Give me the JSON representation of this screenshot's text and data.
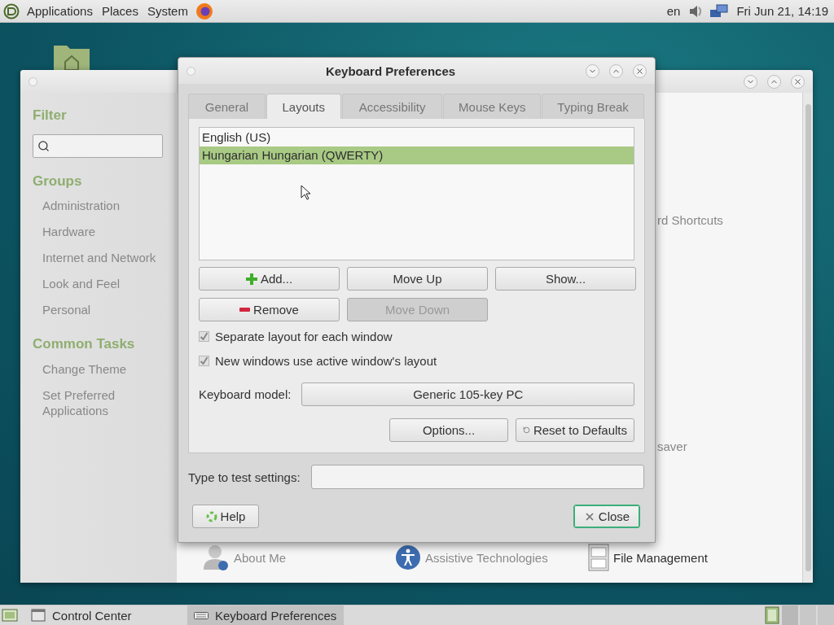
{
  "top_panel": {
    "menus": [
      "Applications",
      "Places",
      "System"
    ],
    "keyboard_layout": "en",
    "clock": "Fri Jun 21, 14:19"
  },
  "control_center": {
    "sidebar": [
      {
        "heading": "Filter",
        "kind": "search"
      },
      {
        "heading": "Groups",
        "kind": "links",
        "items": [
          "Administration",
          "Hardware",
          "Internet and Network",
          "Look and Feel",
          "Personal"
        ]
      },
      {
        "heading": "Common Tasks",
        "kind": "links",
        "items": [
          "Change Theme",
          "Set Preferred Applications"
        ]
      }
    ],
    "partial_items": [
      "rd Shortcuts",
      "saver"
    ],
    "items": [
      {
        "label": "About Me",
        "kind": "person",
        "dimmed": true
      },
      {
        "label": "Assistive Technologies",
        "kind": "accessibility",
        "dimmed": true
      },
      {
        "label": "File Management",
        "kind": "cabinet",
        "dimmed": false
      }
    ]
  },
  "dialog": {
    "title": "Keyboard Preferences",
    "tabs": [
      {
        "label": "General",
        "selected": false
      },
      {
        "label": "Layouts",
        "selected": true
      },
      {
        "label": "Accessibility",
        "selected": false
      },
      {
        "label": "Mouse Keys",
        "selected": false
      },
      {
        "label": "Typing Break",
        "selected": false
      }
    ],
    "layouts": [
      {
        "label": "English (US)",
        "selected": false
      },
      {
        "label": "Hungarian Hungarian (QWERTY)",
        "selected": true
      }
    ],
    "layout_buttons": [
      {
        "label": "Add...",
        "kind": "plus",
        "disabled": false
      },
      {
        "label": "Move Up",
        "disabled": false
      },
      {
        "label": "Show...",
        "disabled": false
      },
      {
        "label": "Remove",
        "kind": "minus",
        "disabled": false
      },
      {
        "label": "Move Down",
        "disabled": true
      }
    ],
    "options": [
      {
        "label": "Separate layout for each window",
        "checked": true
      },
      {
        "label": "New windows use active window's layout",
        "checked": true
      }
    ],
    "keyboard_model": {
      "label": "Keyboard model:",
      "value": "Generic 105-key PC"
    },
    "bottom_buttons": [
      {
        "label": "Options..."
      },
      {
        "label": "Reset to Defaults",
        "kind": "reset"
      }
    ],
    "test_field": {
      "label": "Type to test settings:"
    },
    "help_button": {
      "label": "Help"
    },
    "close_button": {
      "label": "Close",
      "focused": true
    }
  },
  "taskbar": {
    "items": [
      {
        "label": "Control Center",
        "kind": "control-center",
        "selected": false
      },
      {
        "label": "Keyboard Preferences",
        "kind": "keyboard",
        "selected": true
      }
    ]
  }
}
